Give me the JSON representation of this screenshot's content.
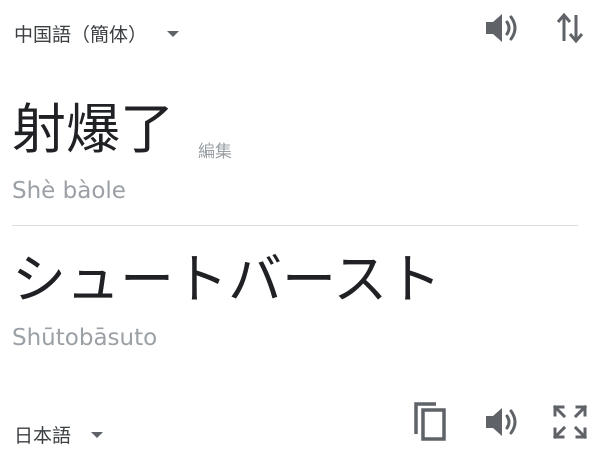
{
  "source": {
    "language": "中国語（簡体）",
    "text": "射爆了",
    "edit_label": "編集",
    "romanization": "Shè bàole"
  },
  "target": {
    "language": "日本語",
    "text": "シュートバースト",
    "romanization": "Shūtobāsuto"
  },
  "icons": {
    "source_language_dropdown": "caret-down-icon",
    "source_speaker": "speaker-icon",
    "swap": "swap-languages-icon",
    "target_language_dropdown": "caret-down-icon",
    "copy": "copy-icon",
    "target_speaker": "speaker-icon",
    "fullscreen": "fullscreen-icon"
  },
  "colors": {
    "primary_text": "#202124",
    "secondary_text": "#9aa0a6",
    "icon": "#5f6368",
    "divider": "#dadce0"
  }
}
